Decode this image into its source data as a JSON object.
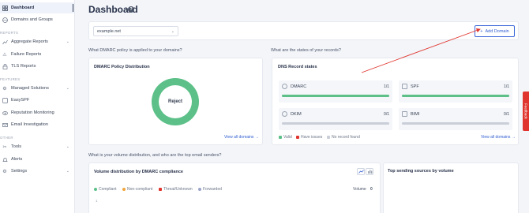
{
  "sidebar": {
    "items_top": [
      {
        "label": "Dashboard",
        "icon": "dashboard-icon",
        "active": true
      },
      {
        "label": "Domains and Groups",
        "icon": "globe-icon"
      }
    ],
    "section_reports": "REPORTS",
    "reports": [
      {
        "label": "Aggregate Reports",
        "icon": "chart-icon",
        "expandable": true
      },
      {
        "label": "Failure Reports",
        "icon": "alert-icon"
      },
      {
        "label": "TLS Reports",
        "icon": "lock-icon"
      }
    ],
    "section_features": "FEATURES",
    "features": [
      {
        "label": "Managed Solutions",
        "icon": "gear-icon",
        "expandable": true
      },
      {
        "label": "EasySPF",
        "icon": "spf-icon"
      },
      {
        "label": "Reputation Monitoring",
        "icon": "eye-icon"
      },
      {
        "label": "Email Investigation",
        "icon": "mail-icon"
      }
    ],
    "section_other": "OTHER",
    "other": [
      {
        "label": "Tools",
        "icon": "tools-icon",
        "expandable": true
      },
      {
        "label": "Alerts",
        "icon": "bell-icon"
      },
      {
        "label": "Settings",
        "icon": "settings-icon",
        "expandable": true
      }
    ]
  },
  "header": {
    "title": "Dashboard",
    "help": "?"
  },
  "domain_select": {
    "value": "example.net"
  },
  "add_domain": {
    "label": "Add Domain",
    "icon": "plus-icon"
  },
  "questions": {
    "policy": "What DMARC policy is applied to your domains?",
    "records": "What are the states of your records?",
    "volume": "What is your volume distribution, and who are the top email senders?"
  },
  "policy_card": {
    "title": "DMARC Policy Distribution",
    "center_label": "Reject",
    "reject_fraction": 1.0,
    "link": "View all domains →"
  },
  "records_card": {
    "title": "DNS Record states",
    "records": [
      {
        "name": "DMARC",
        "count": "1/1",
        "valid_fraction": 1.0
      },
      {
        "name": "SPF",
        "count": "1/1",
        "valid_fraction": 1.0
      },
      {
        "name": "DKIM",
        "count": "0/1",
        "valid_fraction": 0.0
      },
      {
        "name": "BIMI",
        "count": "0/1",
        "valid_fraction": 0.0
      }
    ],
    "legend": [
      {
        "label": "Valid",
        "color": "#5cc088"
      },
      {
        "label": "Have issues",
        "color": "#e0352e"
      },
      {
        "label": "No record found",
        "color": "#c9ced8"
      }
    ],
    "link": "View all domains →"
  },
  "volume_card": {
    "title": "Volume distribution by DMARC compliance",
    "legend": [
      {
        "label": "Compliant",
        "color": "#5cc088"
      },
      {
        "label": "Non-compliant",
        "color": "#f0a53a"
      },
      {
        "label": "Threat/Unknown",
        "color": "#e0352e"
      },
      {
        "label": "Forwarded",
        "color": "#9aa3c8"
      }
    ],
    "volume_label": "Volume",
    "volume_value": "0",
    "axis_tick": "1"
  },
  "senders_card": {
    "title": "Top sending sources by volume"
  },
  "feedback": {
    "label": "Feedback"
  },
  "colors": {
    "accent": "#2f5cd1",
    "valid": "#5cc088",
    "annotation_arrow": "#e0352e"
  }
}
